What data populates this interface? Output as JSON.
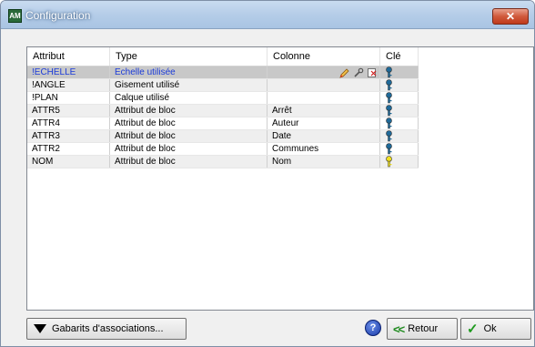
{
  "window": {
    "title": "Configuration",
    "close_label": "✕",
    "app_icon_label": "AM"
  },
  "table": {
    "columns": [
      "Attribut",
      "Type",
      "Colonne",
      "Clé"
    ],
    "rows": [
      {
        "attribut": "!ECHELLE",
        "type": "Echelle utilisée",
        "colonne": "",
        "key": "blue"
      },
      {
        "attribut": "!ANGLE",
        "type": "Gisement utilisé",
        "colonne": "",
        "key": "blue"
      },
      {
        "attribut": "!PLAN",
        "type": "Calque utilisé",
        "colonne": "",
        "key": "blue"
      },
      {
        "attribut": "ATTR5",
        "type": "Attribut de bloc",
        "colonne": "Arrêt",
        "key": "blue"
      },
      {
        "attribut": "ATTR4",
        "type": "Attribut de bloc",
        "colonne": "Auteur",
        "key": "blue"
      },
      {
        "attribut": "ATTR3",
        "type": "Attribut de bloc",
        "colonne": "Date",
        "key": "blue"
      },
      {
        "attribut": "ATTR2",
        "type": "Attribut de bloc",
        "colonne": "Communes",
        "key": "blue"
      },
      {
        "attribut": "NOM",
        "type": "Attribut de bloc",
        "colonne": "Nom",
        "key": "yellow"
      }
    ],
    "selected_row": 0
  },
  "footer": {
    "gabarits_label": "Gabarits d'associations...",
    "help_label": "?",
    "retour_label": "Retour",
    "retour_icon": "<<",
    "ok_label": "Ok",
    "ok_icon": "✓"
  },
  "colors": {
    "key_blue": "#1f6a9a",
    "key_yellow": "#f0e020",
    "selected_text": "#1a3ad8"
  }
}
